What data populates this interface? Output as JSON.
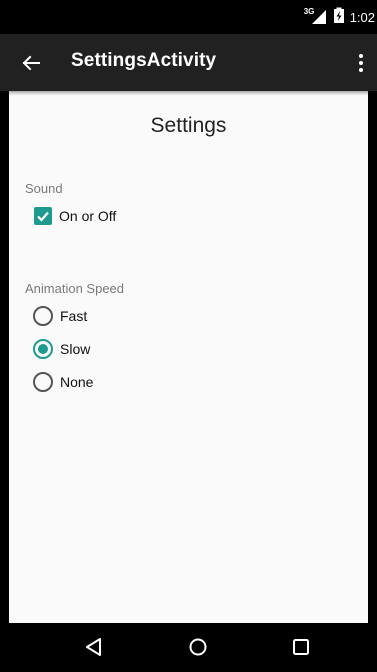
{
  "status_bar": {
    "network_type": "3G",
    "time": "1:02"
  },
  "app_bar": {
    "title": "SettingsActivity",
    "back_icon": "arrow-left-icon",
    "overflow_icon": "more-vert-icon"
  },
  "page": {
    "title": "Settings"
  },
  "sound": {
    "label": "Sound",
    "checkbox_label": "On or Off",
    "checked": true
  },
  "animation": {
    "label": "Animation Speed",
    "options": [
      {
        "label": "Fast",
        "checked": false
      },
      {
        "label": "Slow",
        "checked": true
      },
      {
        "label": "None",
        "checked": false
      }
    ]
  },
  "nav_bar": {
    "back_icon": "nav-back-icon",
    "home_icon": "nav-home-icon",
    "recents_icon": "nav-recents-icon"
  },
  "colors": {
    "accent": "#1e9b8e",
    "app_bar": "#212121",
    "background": "#fafafa"
  }
}
